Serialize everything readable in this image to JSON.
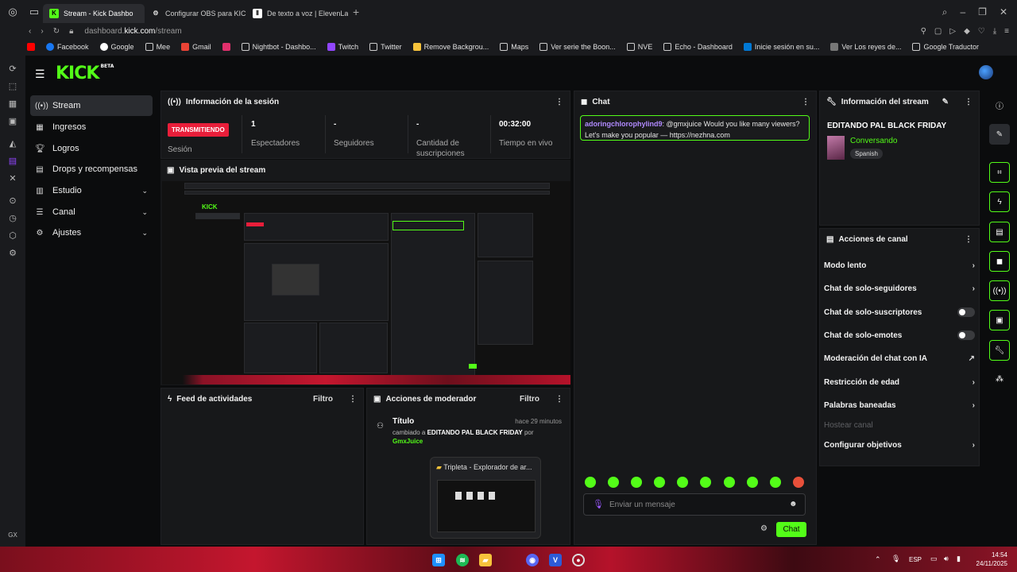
{
  "browser": {
    "tabs": [
      {
        "title": "Stream - Kick Dashbo",
        "active": true
      },
      {
        "title": "Configurar OBS para KICK"
      },
      {
        "title": "De texto a voz | ElevenLab"
      }
    ],
    "url_prefix": "dashboard.",
    "url_domain": "kick.com",
    "url_path": "/stream",
    "bookmarks": [
      "Facebook",
      "Google",
      "Mee",
      "Gmail",
      "Nightbot - Dashbo...",
      "Twitch",
      "Twitter",
      "Remove Backgrou...",
      "Maps",
      "Ver serie the Boon...",
      "NVE",
      "Echo - Dashboard",
      "Inicie sesión en su...",
      "Ver Los reyes de...",
      "Google Traductor"
    ],
    "gx_label": "GX"
  },
  "header": {
    "logo": "KICK",
    "logo_sup": "BETA"
  },
  "nav": {
    "items": [
      {
        "label": "Stream",
        "icon": "stream-icon"
      },
      {
        "label": "Ingresos",
        "icon": "revenue-icon"
      },
      {
        "label": "Logros",
        "icon": "trophy-icon"
      },
      {
        "label": "Drops y recompensas",
        "icon": "drops-icon"
      },
      {
        "label": "Estudio",
        "icon": "studio-icon"
      },
      {
        "label": "Canal",
        "icon": "channel-icon"
      },
      {
        "label": "Ajustes",
        "icon": "gear-icon"
      }
    ]
  },
  "session": {
    "title": "Información de la sesión",
    "status": "TRANSMITIENDO",
    "status_label": "Sesión",
    "stats": [
      {
        "value": "1",
        "label": "Espectadores"
      },
      {
        "value": "-",
        "label": "Seguidores"
      },
      {
        "value": "-",
        "label": "Cantidad de suscripciones"
      },
      {
        "value": "00:32:00",
        "label": "Tiempo en vivo"
      }
    ]
  },
  "preview": {
    "title": "Vista previa del stream"
  },
  "activity": {
    "title": "Feed de actividades",
    "filter": "Filtro"
  },
  "mod": {
    "title": "Acciones de moderador",
    "filter": "Filtro",
    "entry_title": "Título",
    "entry_time": "hace 29 minutos",
    "entry_prefix": "cambiado a",
    "entry_value": "EDITANDO PAL BLACK FRIDAY",
    "entry_by": "por",
    "entry_user": "GmxJuice"
  },
  "chat": {
    "title": "Chat",
    "message_user": "adoringchlorophylind9",
    "message_text": ": @gmxjuice Would you like many viewers? Let's make you popular — https://nezhna.com",
    "input_placeholder": "Enviar un mensaje",
    "send_label": "Chat"
  },
  "stream_info": {
    "title": "Información del stream",
    "stream_title": "EDITANDO PAL BLACK FRIDAY",
    "category": "Conversando",
    "language": "Spanish"
  },
  "channel_actions": {
    "title": "Acciones de canal",
    "items": [
      {
        "label": "Modo lento",
        "type": "chevron"
      },
      {
        "label": "Chat de solo-seguidores",
        "type": "chevron"
      },
      {
        "label": "Chat de solo-suscriptores",
        "type": "toggle"
      },
      {
        "label": "Chat de solo-emotes",
        "type": "toggle"
      },
      {
        "label": "Moderación del chat con IA",
        "type": "external"
      },
      {
        "label": "Restricción de edad",
        "type": "chevron"
      },
      {
        "label": "Palabras baneadas",
        "type": "chevron"
      },
      {
        "label": "Hostear canal",
        "type": "disabled"
      },
      {
        "label": "Configurar objetivos",
        "type": "chevron"
      }
    ]
  },
  "taskbar": {
    "explorer_title": "Tripleta - Explorador de ar...",
    "lang": "ESP",
    "time": "14:54",
    "date": "24/11/2025"
  },
  "colors": {
    "accent": "#53fc18",
    "live": "#e91e3a",
    "panel": "#17181a",
    "chat_user": "#b18aff"
  }
}
